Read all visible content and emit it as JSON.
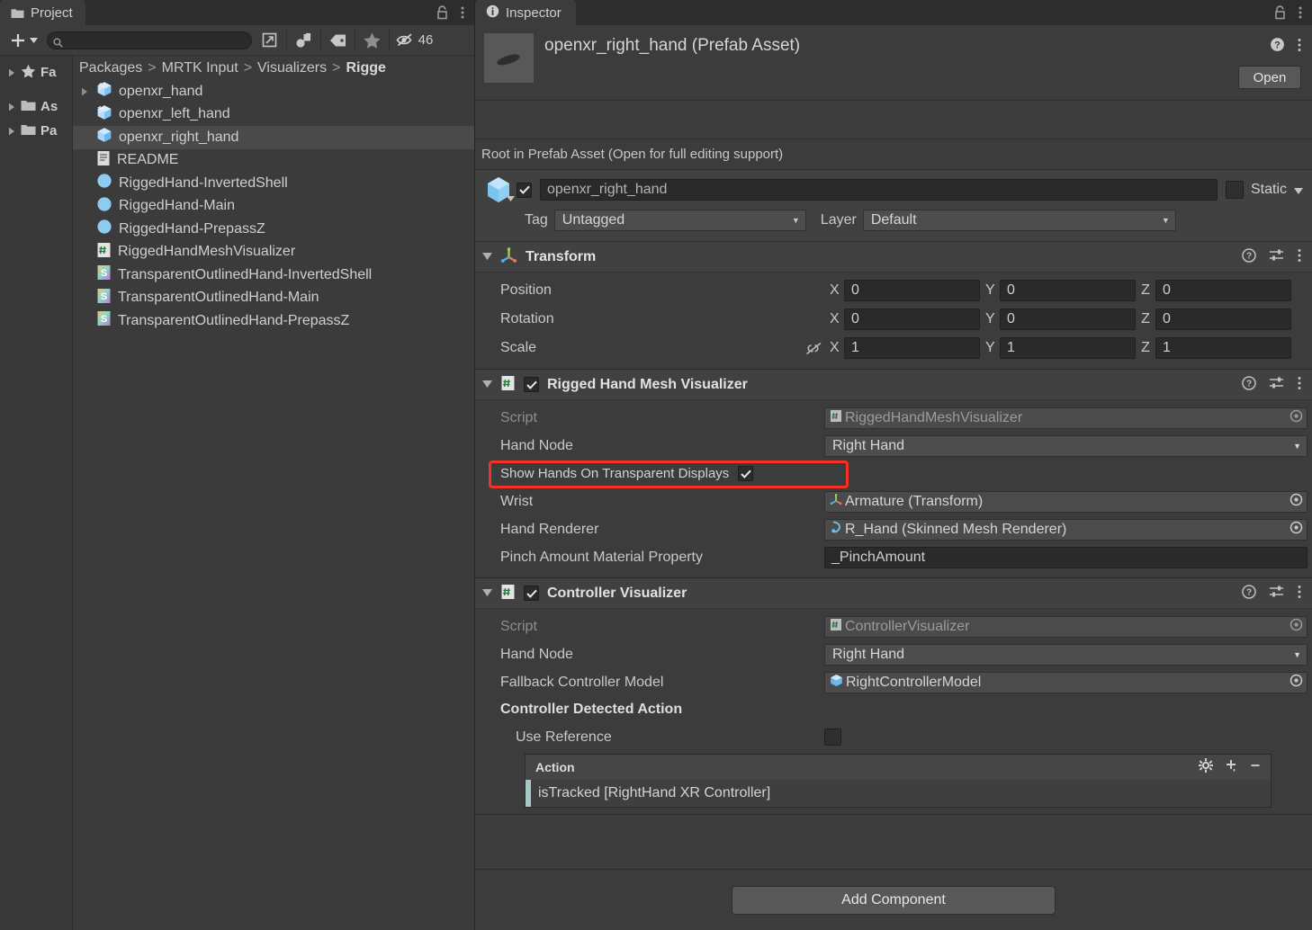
{
  "project": {
    "tab_label": "Project",
    "tab_icon": "folder-icon",
    "toolbar": {
      "create_label": "+",
      "search_value": "",
      "search_placeholder": "",
      "hidden_count": "46"
    },
    "tree": [
      {
        "label": "Fa",
        "icon": "star-icon",
        "expandable": true
      },
      {
        "label": "As",
        "icon": "folder-icon",
        "expandable": true
      },
      {
        "label": "Pa",
        "icon": "folder-icon",
        "expandable": true
      }
    ],
    "breadcrumb": [
      "Packages",
      "MRTK Input",
      "Visualizers",
      "Rigge"
    ],
    "files": [
      {
        "name": "openxr_hand",
        "icon": "prefab-icon",
        "expandable": true,
        "selected": false
      },
      {
        "name": "openxr_left_hand",
        "icon": "prefab-variant-icon",
        "expandable": false,
        "selected": false
      },
      {
        "name": "openxr_right_hand",
        "icon": "prefab-icon",
        "expandable": false,
        "selected": true
      },
      {
        "name": "README",
        "icon": "text-file-icon",
        "expandable": false,
        "selected": false
      },
      {
        "name": "RiggedHand-InvertedShell",
        "icon": "material-icon",
        "expandable": false,
        "selected": false
      },
      {
        "name": "RiggedHand-Main",
        "icon": "material-icon",
        "expandable": false,
        "selected": false
      },
      {
        "name": "RiggedHand-PrepassZ",
        "icon": "material-icon",
        "expandable": false,
        "selected": false
      },
      {
        "name": "RiggedHandMeshVisualizer",
        "icon": "csharp-script-icon",
        "expandable": false,
        "selected": false
      },
      {
        "name": "TransparentOutlinedHand-InvertedShell",
        "icon": "shader-icon",
        "expandable": false,
        "selected": false
      },
      {
        "name": "TransparentOutlinedHand-Main",
        "icon": "shader-icon",
        "expandable": false,
        "selected": false
      },
      {
        "name": "TransparentOutlinedHand-PrepassZ",
        "icon": "shader-icon",
        "expandable": false,
        "selected": false
      }
    ]
  },
  "inspector": {
    "tab_label": "Inspector",
    "tab_icon": "info-icon",
    "asset_title": "openxr_right_hand (Prefab Asset)",
    "open_button": "Open",
    "prefab_note": "Root in Prefab Asset (Open for full editing support)",
    "gameobject": {
      "enabled": true,
      "name": "openxr_right_hand",
      "static_label": "Static",
      "static_checked": false,
      "tag_label": "Tag",
      "tag_value": "Untagged",
      "layer_label": "Layer",
      "layer_value": "Default"
    },
    "transform": {
      "title": "Transform",
      "enabled": true,
      "rows": [
        {
          "label": "Position",
          "x": "0",
          "y": "0",
          "z": "0",
          "lock": false
        },
        {
          "label": "Rotation",
          "x": "0",
          "y": "0",
          "z": "0",
          "lock": false
        },
        {
          "label": "Scale",
          "x": "1",
          "y": "1",
          "z": "1",
          "lock": true
        }
      ],
      "axis_labels": [
        "X",
        "Y",
        "Z"
      ]
    },
    "rigged_hand_mesh_visualizer": {
      "title": "Rigged Hand Mesh Visualizer",
      "enabled": true,
      "script_label": "Script",
      "script_value": "RiggedHandMeshVisualizer",
      "hand_node_label": "Hand Node",
      "hand_node_value": "Right Hand",
      "show_hands_label": "Show Hands On Transparent Displays",
      "show_hands_checked": true,
      "highlight_color": "#f53025",
      "wrist_label": "Wrist",
      "wrist_value": "Armature (Transform)",
      "hand_renderer_label": "Hand Renderer",
      "hand_renderer_value": "R_Hand (Skinned Mesh Renderer)",
      "pinch_label": "Pinch Amount Material Property",
      "pinch_value": "_PinchAmount"
    },
    "controller_visualizer": {
      "title": "Controller Visualizer",
      "enabled": true,
      "script_label": "Script",
      "script_value": "ControllerVisualizer",
      "hand_node_label": "Hand Node",
      "hand_node_value": "Right Hand",
      "fallback_label": "Fallback Controller Model",
      "fallback_value": "RightControllerModel",
      "detected_action_label": "Controller Detected Action",
      "use_reference_label": "Use Reference",
      "use_reference_checked": false,
      "action_list_header": "Action",
      "action_items": [
        "isTracked [RightHand XR Controller]"
      ]
    },
    "add_component_label": "Add Component"
  }
}
